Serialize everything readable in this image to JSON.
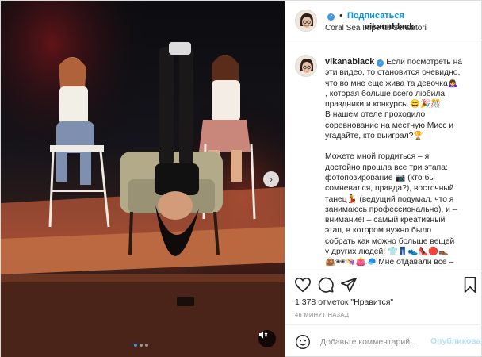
{
  "post": {
    "username": "vikanablack",
    "follow_label": "Подписаться",
    "location": "Coral Sea Imperial Sensatori",
    "separator": "•"
  },
  "caption": {
    "username": "vikanablack",
    "lines": [
      "Если посмотреть на",
      "эти видео, то становится очевидно,",
      "что во мне еще жива та девочка🙇‍♀️",
      ", которая больше всего любила",
      "праздники и конкурсы.😄🎉🎊",
      "В нашем отеле проходило",
      "соревнование на местную Мисс и",
      "угадайте, кто выиграл?🏆",
      "",
      "Можете мной гордиться – я",
      "достойно прошла все три этапа:",
      "фотопозирование 📷 (кто бы",
      "сомневался, правда?), восточный",
      "танец💃 (ведущий подумал, что я",
      "занимаюсь профессионально), и –",
      "внимание! – самый креативный",
      "этап, в котором нужно было",
      "собрать как можно больше вещей",
      "у других людей! 👕👖👟👠🔴👞",
      "👜🕶👒👛🧢 Мне отдавали все –"
    ]
  },
  "stats": {
    "likes": "1 378 отметок \"Нравится\"",
    "time_ago": "46 МИНУТ НАЗАД"
  },
  "comment": {
    "placeholder": "Добавьте комментарий...",
    "publish_label": "Опубликовать"
  },
  "icons": {
    "like": "heart-icon",
    "comment": "comment-icon",
    "share": "share-icon",
    "save": "bookmark-icon",
    "emoji": "smiley-icon",
    "mute": "speaker-muted-icon",
    "next": "chevron-right-icon"
  },
  "carousel": {
    "slides": 3,
    "active_index": 0
  },
  "colors": {
    "accent": "#0095f6",
    "verified": "#3897f0",
    "muted_text": "#8e8e8e",
    "disabled_link": "#b2dffc"
  }
}
